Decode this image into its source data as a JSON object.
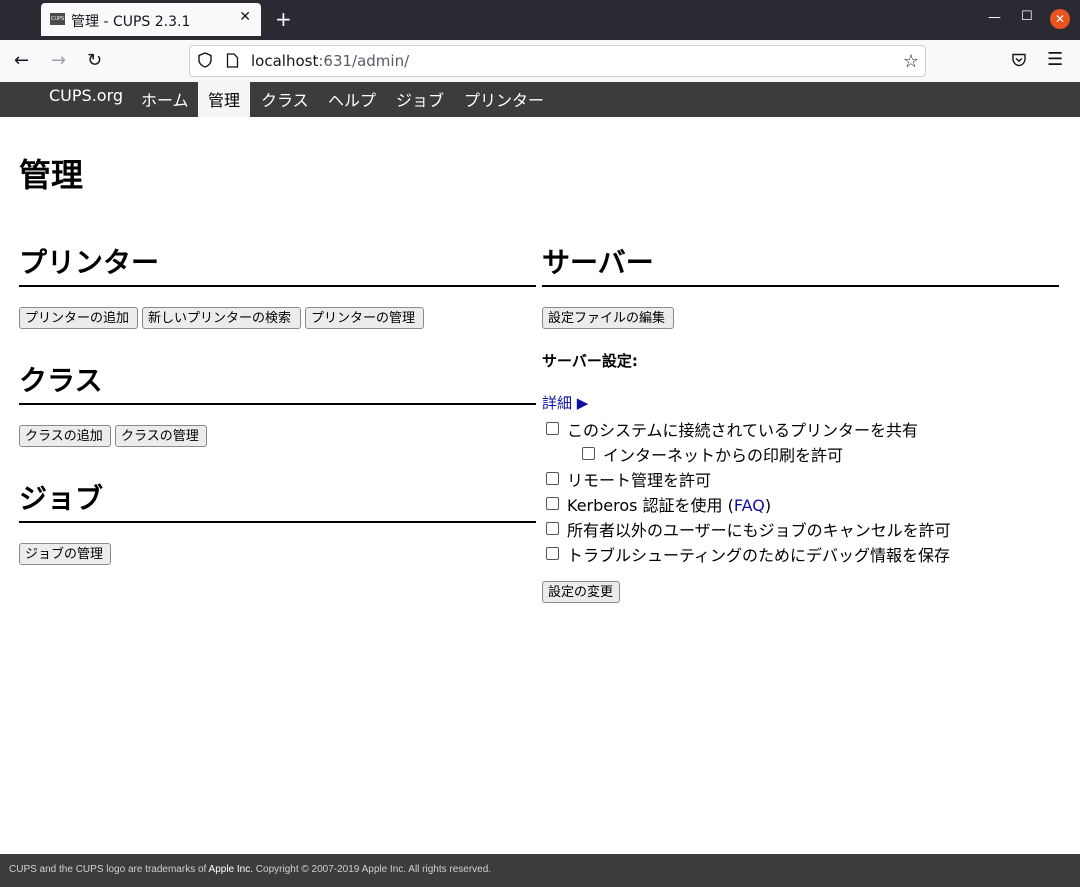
{
  "browser": {
    "tab_title": "管理 - CUPS 2.3.1",
    "favicon_text": "CUPS",
    "url_host": "localhost",
    "url_rest": ":631/admin/"
  },
  "nav": {
    "logo": "CUPS.org",
    "items": [
      "ホーム",
      "管理",
      "クラス",
      "ヘルプ",
      "ジョブ",
      "プリンター"
    ],
    "active": "管理"
  },
  "page": {
    "title": "管理"
  },
  "printers": {
    "heading": "プリンター",
    "buttons": [
      "プリンターの追加",
      "新しいプリンターの検索",
      "プリンターの管理"
    ]
  },
  "classes": {
    "heading": "クラス",
    "buttons": [
      "クラスの追加",
      "クラスの管理"
    ]
  },
  "jobs": {
    "heading": "ジョブ",
    "buttons": [
      "ジョブの管理"
    ]
  },
  "server": {
    "heading": "サーバー",
    "edit_config_button": "設定ファイルの編集",
    "settings_label": "サーバー設定:",
    "advanced_link": "詳細 ▶",
    "options": [
      {
        "label": "このシステムに接続されているプリンターを共有",
        "checked": false
      },
      {
        "label": "インターネットからの印刷を許可",
        "checked": false
      },
      {
        "label": "リモート管理を許可",
        "checked": false
      },
      {
        "label": "Kerberos 認証を使用 (",
        "link": "FAQ",
        "suffix": ")",
        "checked": false
      },
      {
        "label": "所有者以外のユーザーにもジョブのキャンセルを許可",
        "checked": false
      },
      {
        "label": "トラブルシューティングのためにデバッグ情報を保存",
        "checked": false
      }
    ],
    "change_settings_button": "設定の変更"
  },
  "footer": {
    "part1": "CUPS and the CUPS logo are trademarks of ",
    "apple": "Apple Inc.",
    "part2": " Copyright © 2007-2019 Apple Inc. All rights reserved."
  }
}
